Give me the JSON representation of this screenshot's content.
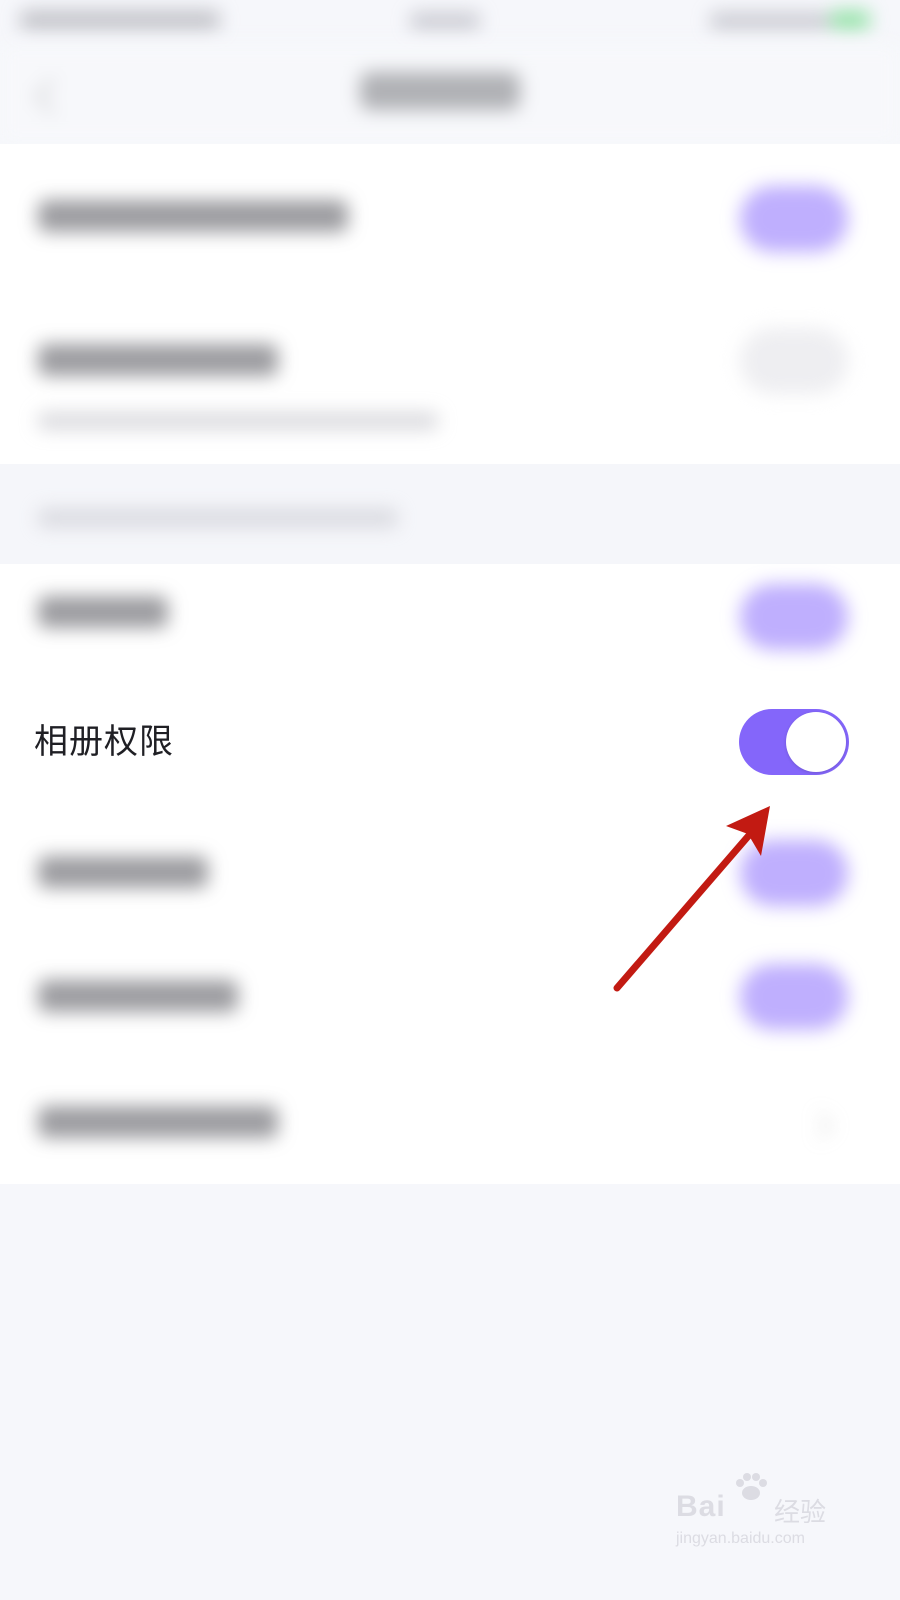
{
  "page": {
    "background_color": "#f6f7fb",
    "content_color": "#ffffff"
  },
  "focus_row": {
    "label": "相册权限",
    "toggle": {
      "state": "on",
      "track_color": "#8466fa",
      "knob_color": "#ffffff"
    }
  },
  "blurred_rows": [
    {
      "toggle": "on"
    },
    {
      "toggle": "off"
    },
    {
      "toggle": "on"
    },
    {
      "toggle": "on"
    },
    {
      "toggle": "on"
    },
    {
      "toggle": "off"
    }
  ],
  "annotation": {
    "icon": "arrow-icon",
    "color": "#c21a12"
  },
  "watermark": {
    "brand": "Bai",
    "brand_suffix": "经验",
    "url": "jingyan.baidu.com",
    "logo_icon": "paw-icon"
  }
}
